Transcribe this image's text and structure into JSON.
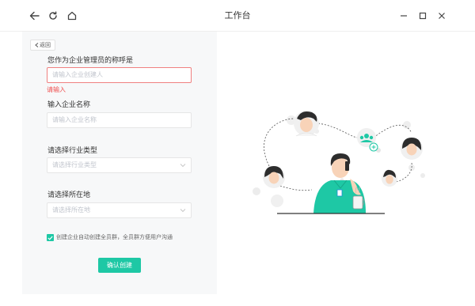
{
  "window": {
    "title": "工作台"
  },
  "form": {
    "back_label": "返回",
    "name_label": "您作为企业管理员的称呼是",
    "name_placeholder": "请输入企业创建人",
    "name_error": "请输入",
    "company_label": "输入企业名称",
    "company_placeholder": "请输入企业名称",
    "industry_label": "请选择行业类型",
    "industry_placeholder": "请选择行业类型",
    "location_label": "请选择所在地",
    "location_placeholder": "请选择所在地",
    "auto_group_text": "创建企业自动创建全员群，全员群方便用户沟通",
    "auto_group_checked": true,
    "submit_label": "确认创建"
  },
  "colors": {
    "accent": "#1ec8a5",
    "error": "#f05050",
    "panel_bg": "#f7f8f9"
  }
}
